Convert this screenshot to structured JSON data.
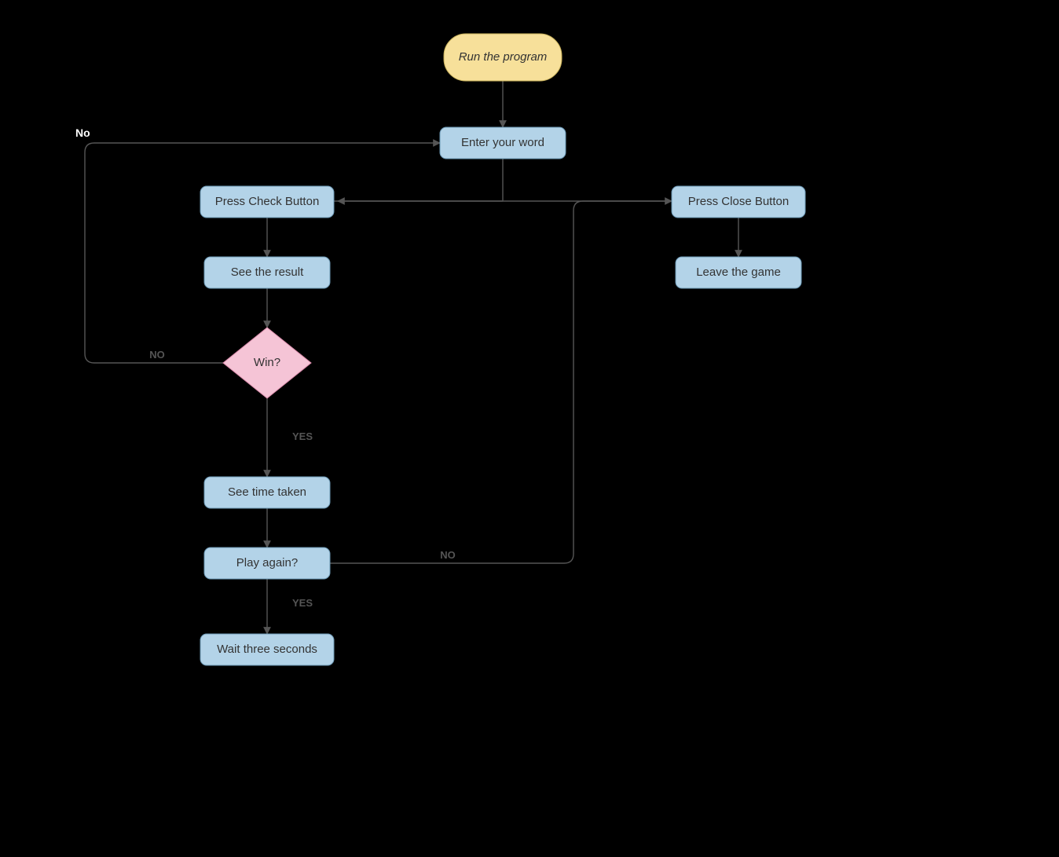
{
  "nodes": {
    "start": "Run the program",
    "enter": "Enter your word",
    "pressCheck": "Press Check Button",
    "seeResult": "See the result",
    "win": "Win?",
    "seeTime": "See time taken",
    "playAgain": "Play again?",
    "wait": "Wait three seconds",
    "pressClose": "Press Close Button",
    "leave": "Leave the game"
  },
  "edgeLabels": {
    "winNo": "NO",
    "topNo": "No",
    "winYes": "YES",
    "playAgainNo": "NO",
    "playAgainYes": "YES"
  }
}
